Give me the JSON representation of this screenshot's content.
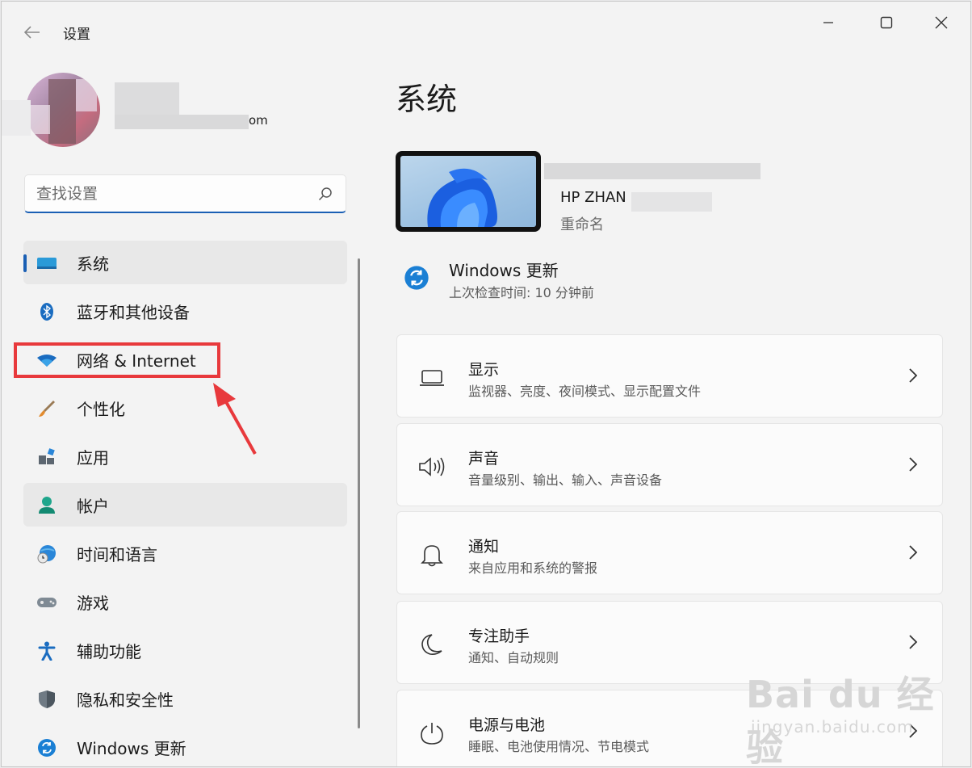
{
  "window": {
    "title": "设置"
  },
  "profile": {
    "email_suffix": "om"
  },
  "search": {
    "placeholder": "查找设置"
  },
  "nav": {
    "items": [
      {
        "label": "系统",
        "icon": "monitor-icon",
        "selected": true
      },
      {
        "label": "蓝牙和其他设备",
        "icon": "bluetooth-icon"
      },
      {
        "label": "网络 & Internet",
        "icon": "wifi-icon"
      },
      {
        "label": "个性化",
        "icon": "brush-icon"
      },
      {
        "label": "应用",
        "icon": "apps-icon"
      },
      {
        "label": "帐户",
        "icon": "account-icon"
      },
      {
        "label": "时间和语言",
        "icon": "globe-clock-icon"
      },
      {
        "label": "游戏",
        "icon": "gamepad-icon"
      },
      {
        "label": "辅助功能",
        "icon": "accessibility-icon"
      },
      {
        "label": "隐私和安全性",
        "icon": "shield-icon"
      },
      {
        "label": "Windows 更新",
        "icon": "update-icon"
      }
    ]
  },
  "main": {
    "title": "系统",
    "device": {
      "name": "HP ZHAN",
      "rename": "重命名"
    },
    "update": {
      "title": "Windows 更新",
      "subtitle": "上次检查时间: 10 分钟前"
    },
    "cards": [
      {
        "title": "显示",
        "subtitle": "监视器、亮度、夜间模式、显示配置文件",
        "icon": "laptop-icon"
      },
      {
        "title": "声音",
        "subtitle": "音量级别、输出、输入、声音设备",
        "icon": "speaker-icon"
      },
      {
        "title": "通知",
        "subtitle": "来自应用和系统的警报",
        "icon": "bell-icon"
      },
      {
        "title": "专注助手",
        "subtitle": "通知、自动规则",
        "icon": "moon-icon"
      },
      {
        "title": "电源与电池",
        "subtitle": "睡眠、电池使用情况、节电模式",
        "icon": "power-icon"
      }
    ]
  },
  "watermark": {
    "main": "Bai du 经验",
    "url": "jingyan.baidu.com"
  },
  "colors": {
    "accent": "#1a5fb4",
    "annotation": "#e8393c"
  }
}
